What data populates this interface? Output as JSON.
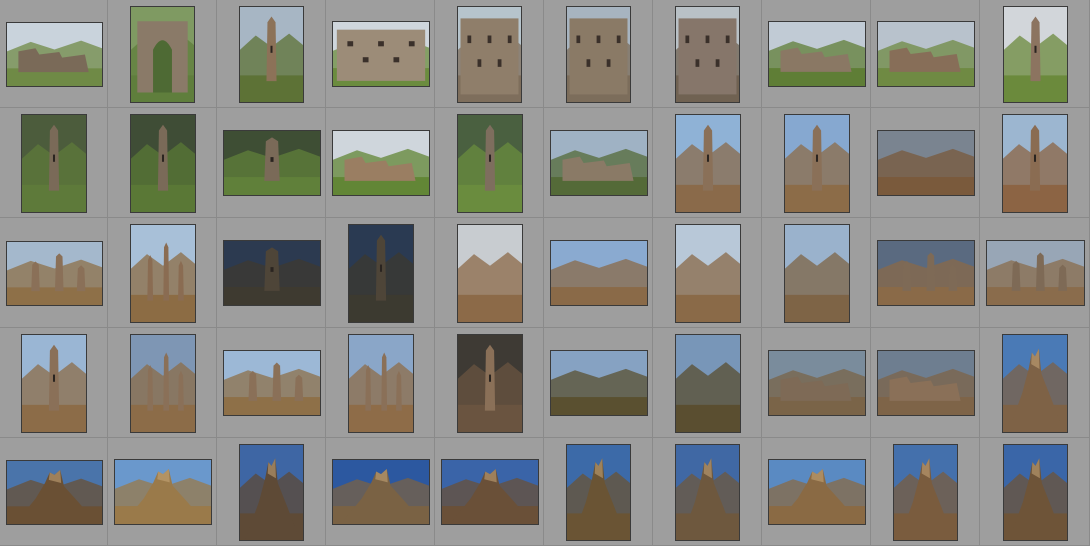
{
  "grid": {
    "columns": 10,
    "rows": 5,
    "background": "#a0a0a0",
    "cell_divider_color": "#8a8a8a",
    "thumb_border_color": "#3a3a3a"
  },
  "thumbnails": [
    {
      "o": "l",
      "s": "#c9d3dc",
      "g": "#6f8a46",
      "m": "#7a6a58",
      "sub": "ruin"
    },
    {
      "o": "p",
      "s": "#7f9a62",
      "g": "#5f7e3c",
      "m": "#8a7a68",
      "sub": "arch"
    },
    {
      "o": "p",
      "s": "#a7b6c4",
      "g": "#5d7236",
      "m": "#8c7258",
      "sub": "tower"
    },
    {
      "o": "l",
      "s": "#cfd6dc",
      "g": "#6b8c3e",
      "m": "#9c8c78",
      "sub": "wall"
    },
    {
      "o": "p",
      "s": "#b6c4cc",
      "g": "#7e6e5c",
      "m": "#8f7e6a",
      "sub": "wall"
    },
    {
      "o": "p",
      "s": "#a7b4c0",
      "g": "#7c6d5b",
      "m": "#8a7a66",
      "sub": "wall"
    },
    {
      "o": "p",
      "s": "#b9c1c6",
      "g": "#706252",
      "m": "#86766a",
      "sub": "wall"
    },
    {
      "o": "l",
      "s": "#c1cbd5",
      "g": "#5f7e36",
      "m": "#8a7864",
      "sub": "ruin"
    },
    {
      "o": "l",
      "s": "#b8c2cc",
      "g": "#6f8a43",
      "m": "#876e58",
      "sub": "ruin"
    },
    {
      "o": "p",
      "s": "#d2d6da",
      "g": "#6b8a3c",
      "m": "#8c7460",
      "sub": "tower"
    },
    {
      "o": "p",
      "s": "#4c5c3c",
      "g": "#5e7a3a",
      "m": "#7a6a58",
      "sub": "tower"
    },
    {
      "o": "p",
      "s": "#3f4d36",
      "g": "#5a7836",
      "m": "#7a6a58",
      "sub": "tower"
    },
    {
      "o": "l",
      "s": "#3e4e34",
      "g": "#60803a",
      "m": "#7a6a58",
      "sub": "tower"
    },
    {
      "o": "l",
      "s": "#cfd6dc",
      "g": "#628636",
      "m": "#9a7e62",
      "sub": "ruin"
    },
    {
      "o": "p",
      "s": "#4a6040",
      "g": "#6a8c3e",
      "m": "#7e6e5e",
      "sub": "tower"
    },
    {
      "o": "l",
      "s": "#9fb2c4",
      "g": "#546a38",
      "m": "#8a7a66",
      "sub": "ruin"
    },
    {
      "o": "p",
      "s": "#8fb2d6",
      "g": "#8a6a4a",
      "m": "#8a7058",
      "sub": "tower"
    },
    {
      "o": "p",
      "s": "#86a8d0",
      "g": "#8c6c48",
      "m": "#8a7058",
      "sub": "tower"
    },
    {
      "o": "l",
      "s": "#7a8490",
      "g": "#7a5a3c",
      "m": "#6a5040",
      "sub": "none"
    },
    {
      "o": "p",
      "s": "#9cb6d0",
      "g": "#8c6444",
      "m": "#8a6c52",
      "sub": "tower"
    },
    {
      "o": "l",
      "s": "#a4b8cc",
      "g": "#8e7048",
      "m": "#8a7058",
      "sub": "towers"
    },
    {
      "o": "p",
      "s": "#a8c0d8",
      "g": "#8c6c44",
      "m": "#8a6c52",
      "sub": "towers"
    },
    {
      "o": "l",
      "s": "#2c3a50",
      "g": "#3e3a30",
      "m": "#4e4538",
      "sub": "tower"
    },
    {
      "o": "p",
      "s": "#2a3a52",
      "g": "#3c3a30",
      "m": "#4e4538",
      "sub": "tower"
    },
    {
      "o": "p",
      "s": "#c8ccd0",
      "g": "#8c6a48",
      "m": "#8c6a48",
      "sub": "none"
    },
    {
      "o": "l",
      "s": "#8aaad0",
      "g": "#8a6a48",
      "m": "#8c6a48",
      "sub": "none"
    },
    {
      "o": "p",
      "s": "#b8c8d8",
      "g": "#8a6a48",
      "m": "#8c6a48",
      "sub": "none"
    },
    {
      "o": "p",
      "s": "#9ab2cc",
      "g": "#7e6446",
      "m": "#8c6a48",
      "sub": "none"
    },
    {
      "o": "l",
      "s": "#5a6a80",
      "g": "#8a6a48",
      "m": "#7e6a56",
      "sub": "towers"
    },
    {
      "o": "l",
      "s": "#98a6b6",
      "g": "#8a6c4c",
      "m": "#7e6a56",
      "sub": "towers"
    },
    {
      "o": "p",
      "s": "#9ab6d4",
      "g": "#8c6c48",
      "m": "#8a7058",
      "sub": "tower"
    },
    {
      "o": "p",
      "s": "#7e96b4",
      "g": "#8c6c48",
      "m": "#8a7058",
      "sub": "towers"
    },
    {
      "o": "l",
      "s": "#9cb8d6",
      "g": "#8e7048",
      "m": "#8a7058",
      "sub": "towers"
    },
    {
      "o": "p",
      "s": "#8aa6c8",
      "g": "#8e6c48",
      "m": "#8a7058",
      "sub": "towers"
    },
    {
      "o": "p",
      "s": "#3e3a34",
      "g": "#6a5440",
      "m": "#8a7058",
      "sub": "tower"
    },
    {
      "o": "l",
      "s": "#86a2c2",
      "g": "#5a5030",
      "m": "#7e6a56",
      "sub": "none"
    },
    {
      "o": "p",
      "s": "#7896b8",
      "g": "#5a4e30",
      "m": "#7e6a56",
      "sub": "none"
    },
    {
      "o": "l",
      "s": "#7a8c9c",
      "g": "#7a6448",
      "m": "#7e6a56",
      "sub": "ruin"
    },
    {
      "o": "l",
      "s": "#6e7e90",
      "g": "#7e6448",
      "m": "#8a7058",
      "sub": "ruin"
    },
    {
      "o": "p",
      "s": "#4a7ab6",
      "g": "#7e6246",
      "m": "#8a6c52",
      "sub": "rock"
    },
    {
      "o": "l",
      "s": "#4a74aa",
      "g": "#6a5034",
      "m": "#6e5438",
      "sub": "rock"
    },
    {
      "o": "l",
      "s": "#6a98cc",
      "g": "#9a7a4a",
      "m": "#8c6a44",
      "sub": "rock"
    },
    {
      "o": "p",
      "s": "#3e66a4",
      "g": "#5e4a36",
      "m": "#6e563e",
      "sub": "rock"
    },
    {
      "o": "l",
      "s": "#2c58a0",
      "g": "#7a6244",
      "m": "#6e563e",
      "sub": "rock"
    },
    {
      "o": "l",
      "s": "#3a64a8",
      "g": "#6a5038",
      "m": "#6e563e",
      "sub": "rock"
    },
    {
      "o": "p",
      "s": "#3c6aa8",
      "g": "#6a5434",
      "m": "#6e563e",
      "sub": "rock"
    },
    {
      "o": "p",
      "s": "#4068a4",
      "g": "#6e583e",
      "m": "#6e563e",
      "sub": "rock"
    },
    {
      "o": "l",
      "s": "#5a8ac2",
      "g": "#8a6a44",
      "m": "#7e6446",
      "sub": "rock"
    },
    {
      "o": "p",
      "s": "#4470ac",
      "g": "#7a5c3e",
      "m": "#6e563e",
      "sub": "rock"
    },
    {
      "o": "p",
      "s": "#3a66a8",
      "g": "#6e5438",
      "m": "#6e563e",
      "sub": "rock"
    }
  ]
}
